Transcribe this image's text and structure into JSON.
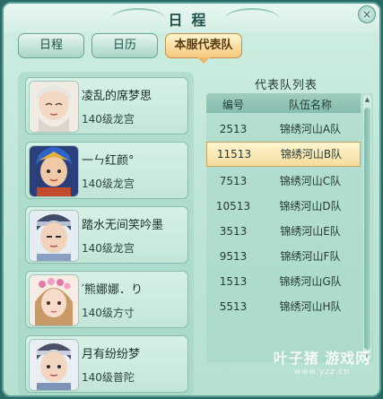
{
  "window": {
    "title": "日程",
    "close_glyph": "×"
  },
  "tabs": [
    {
      "label": "日程",
      "active": false
    },
    {
      "label": "日历",
      "active": false
    },
    {
      "label": "本服代表队",
      "active": true
    }
  ],
  "members": [
    {
      "name": "凌乱的席梦思",
      "level": "140级龙宫",
      "avatar": "elder-portrait"
    },
    {
      "name": "一ㄣ红颜°",
      "level": "140级龙宫",
      "avatar": "warrior-portrait"
    },
    {
      "name": "踏水无间笑吟墨",
      "level": "140级龙宫",
      "avatar": "swordsman-portrait"
    },
    {
      "name": "′熊娜娜．り",
      "level": "140级方寸",
      "avatar": "maiden-portrait"
    },
    {
      "name": "月有纷纷梦",
      "level": "140级普陀",
      "avatar": "youth-portrait"
    }
  ],
  "team_list": {
    "title": "代表队列表",
    "headers": {
      "id": "编号",
      "name": "队伍名称"
    },
    "rows": [
      {
        "id": "2513",
        "name": "锦绣河山A队",
        "selected": false
      },
      {
        "id": "11513",
        "name": "锦绣河山B队",
        "selected": true
      },
      {
        "id": "7513",
        "name": "锦绣河山C队",
        "selected": false
      },
      {
        "id": "10513",
        "name": "锦绣河山D队",
        "selected": false
      },
      {
        "id": "3513",
        "name": "锦绣河山E队",
        "selected": false
      },
      {
        "id": "9513",
        "name": "锦绣河山F队",
        "selected": false
      },
      {
        "id": "1513",
        "name": "锦绣河山G队",
        "selected": false
      },
      {
        "id": "5513",
        "name": "锦绣河山H队",
        "selected": false
      }
    ]
  },
  "watermark": {
    "main": "叶子猪 游戏网",
    "sub": "www.yzz.cn"
  },
  "colors": {
    "accent": "#f4c97d",
    "panel": "#bfe6d8",
    "border": "#5a9f95"
  }
}
